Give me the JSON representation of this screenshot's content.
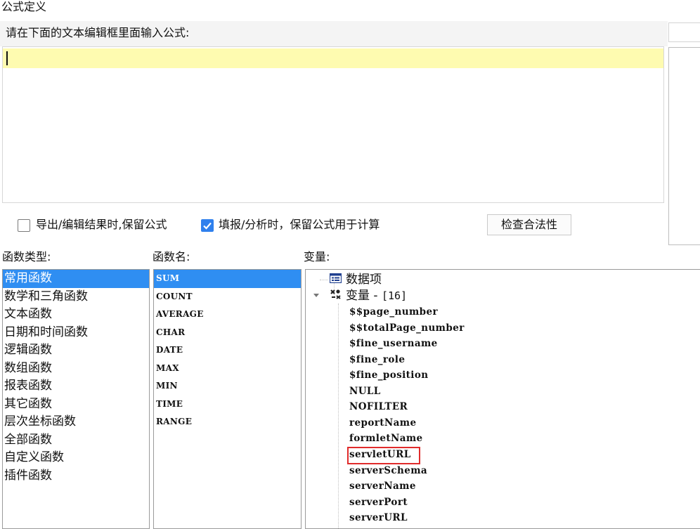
{
  "window": {
    "title": "公式定义"
  },
  "editor": {
    "instruction": "请在下面的文本编辑框里面输入公式:",
    "value": ""
  },
  "options": {
    "keep_formula_export_label": "导出/编辑结果时,保留公式",
    "keep_formula_export_checked": false,
    "keep_formula_fill_label": "填报/分析时，保留公式用于计算",
    "keep_formula_fill_checked": true,
    "check_validity_label": "检查合法性"
  },
  "function_types": {
    "heading": "函数类型:",
    "items": [
      "常用函数",
      "数学和三角函数",
      "文本函数",
      "日期和时间函数",
      "逻辑函数",
      "数组函数",
      "报表函数",
      "其它函数",
      "层次坐标函数",
      "全部函数",
      "自定义函数",
      "插件函数"
    ],
    "selected_index": 0
  },
  "function_names": {
    "heading": "函数名:",
    "items": [
      "SUM",
      "COUNT",
      "AVERAGE",
      "CHAR",
      "DATE",
      "MAX",
      "MIN",
      "TIME",
      "RANGE"
    ],
    "selected_index": 0
  },
  "variables": {
    "heading": "变量:",
    "data_items_label": "数据项",
    "variables_label": "变量 - ",
    "variables_count": "[16]",
    "items": [
      "$$page_number",
      "$$totalPage_number",
      "$fine_username",
      "$fine_role",
      "$fine_position",
      "NULL",
      "NOFILTER",
      "reportName",
      "formletName",
      "servletURL",
      "serverSchema",
      "serverName",
      "serverPort",
      "serverURL"
    ],
    "highlighted_index": 9
  },
  "colors": {
    "selection": "#2f8ef2",
    "current_line": "#fefbb0",
    "highlight_box": "#e02b2b",
    "checkbox_checked": "#2f80ed"
  }
}
